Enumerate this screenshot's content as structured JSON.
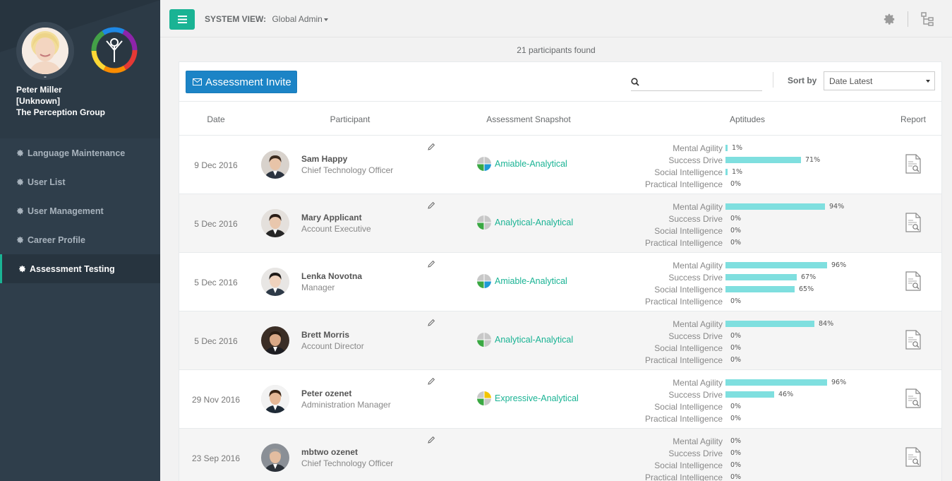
{
  "sidebar": {
    "user_name": "Peter Miller",
    "user_role": "[Unknown]",
    "company": "The Perception Group",
    "nav": [
      {
        "label": "Language Maintenance",
        "active": false
      },
      {
        "label": "User List",
        "active": false
      },
      {
        "label": "User Management",
        "active": false
      },
      {
        "label": "Career Profile",
        "active": false
      },
      {
        "label": "Assessment Testing",
        "active": true
      }
    ]
  },
  "topbar": {
    "system_view_label": "SYSTEM VIEW:",
    "system_view_value": "Global Admin",
    "icons": [
      "menu-icon",
      "gear-icon",
      "sitemap-icon"
    ]
  },
  "participants_count": "21 participants found",
  "toolbar": {
    "invite_label": "Assessment Invite",
    "search_placeholder": "",
    "sort_label": "Sort by",
    "sort_value": "Date Latest"
  },
  "table": {
    "headers": [
      "Date",
      "Participant",
      "Assessment Snapshot",
      "Aptitudes",
      "Report"
    ],
    "aptitude_labels": [
      "Mental Agility",
      "Success Drive",
      "Social Intelligence",
      "Practical Intelligence"
    ],
    "rows": [
      {
        "date": "9 Dec 2016",
        "name": "Sam Happy",
        "title": "Chief Technology Officer",
        "snapshot": "Amiable-Analytical",
        "quadrants": [
          "#c8c8c8",
          "#c8c8c8",
          "#1e9ad6",
          "#3aa843"
        ],
        "aptitudes": [
          1,
          71,
          1,
          0
        ],
        "photo": {
          "bg": "#d8d2cc",
          "hair": "#3a2a1e",
          "skin": "#e8c4a8",
          "suit": "#2c3440"
        }
      },
      {
        "date": "5 Dec 2016",
        "name": "Mary Applicant",
        "title": "Account Executive",
        "snapshot": "Analytical-Analytical",
        "quadrants": [
          "#c8c8c8",
          "#c8c8c8",
          "#c8c8c8",
          "#3aa843"
        ],
        "aptitudes": [
          94,
          0,
          0,
          0
        ],
        "photo": {
          "bg": "#e4e0dc",
          "hair": "#2a1d16",
          "skin": "#e9c7ad",
          "suit": "#262626"
        }
      },
      {
        "date": "5 Dec 2016",
        "name": "Lenka Novotna",
        "title": "Manager",
        "snapshot": "Amiable-Analytical",
        "quadrants": [
          "#c8c8c8",
          "#c8c8c8",
          "#1e9ad6",
          "#3aa843"
        ],
        "aptitudes": [
          96,
          67,
          65,
          0
        ],
        "photo": {
          "bg": "#e8e6e4",
          "hair": "#1e1a18",
          "skin": "#efd2bd",
          "suit": "#2e3a48"
        }
      },
      {
        "date": "5 Dec 2016",
        "name": "Brett Morris",
        "title": "Account Director",
        "snapshot": "Analytical-Analytical",
        "quadrants": [
          "#c8c8c8",
          "#c8c8c8",
          "#c8c8c8",
          "#3aa843"
        ],
        "aptitudes": [
          84,
          0,
          0,
          0
        ],
        "photo": {
          "bg": "#3b2e26",
          "hair": "#2a1c12",
          "skin": "#d9a886",
          "suit": "#1d1d22"
        }
      },
      {
        "date": "29 Nov 2016",
        "name": "Peter ozenet",
        "title": "Administration Manager",
        "snapshot": "Expressive-Analytical",
        "quadrants": [
          "#c8c8c8",
          "#f2c500",
          "#c8c8c8",
          "#3aa843"
        ],
        "aptitudes": [
          96,
          46,
          0,
          0
        ],
        "photo": {
          "bg": "#f2f2f2",
          "hair": "#3a2414",
          "skin": "#e6b896",
          "suit": "#1e2a36"
        }
      },
      {
        "date": "23 Sep 2016",
        "name": "mbtwo ozenet",
        "title": "Chief Technology Officer",
        "snapshot": "",
        "quadrants": [],
        "aptitudes": [
          0,
          0,
          0,
          0
        ],
        "photo": {
          "bg": "#8a8f96",
          "hair": "#9a9a9a",
          "skin": "#e3bda0",
          "suit": "#2a3038"
        }
      }
    ]
  },
  "colors": {
    "sidebar_bg": "#2f3e4b",
    "accent": "#1ab394",
    "invite_btn": "#1c84c6",
    "aptitude_bar": "#7fdfdf"
  }
}
